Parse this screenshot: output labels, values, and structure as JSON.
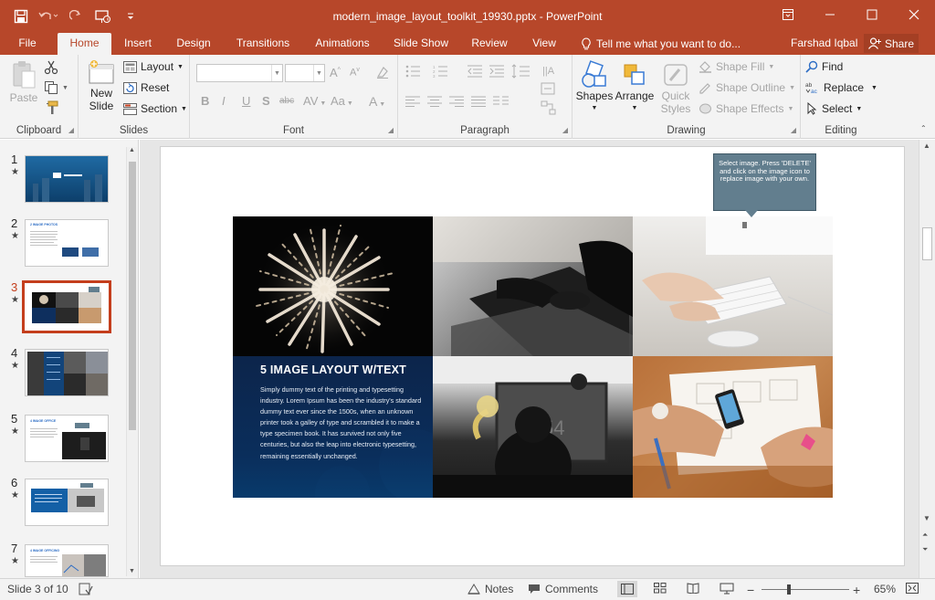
{
  "app": {
    "document_title": "modern_image_layout_toolkit_19930.pptx - PowerPoint"
  },
  "qat": {
    "save_icon": "save-icon",
    "undo_icon": "undo-icon",
    "redo_icon": "redo-icon",
    "present_icon": "present-from-start-icon",
    "customize_icon": "customize-qat-icon"
  },
  "window": {
    "ribbon_display": "ribbon-display-options-icon",
    "minimize": "minimize-icon",
    "restore": "restore-icon",
    "close": "close-icon"
  },
  "tabs": [
    "File",
    "Home",
    "Insert",
    "Design",
    "Transitions",
    "Animations",
    "Slide Show",
    "Review",
    "View"
  ],
  "tell_me": "Tell me what you want to do...",
  "user": "Farshad Iqbal",
  "share": "Share",
  "ribbon": {
    "clipboard": {
      "label": "Clipboard",
      "paste": "Paste"
    },
    "slides": {
      "label": "Slides",
      "new_slide_1": "New",
      "new_slide_2": "Slide",
      "layout": "Layout",
      "reset": "Reset",
      "section": "Section"
    },
    "font": {
      "label": "Font",
      "buttons": [
        "B",
        "I",
        "U",
        "S",
        "abc",
        "AV",
        "Aa",
        "A"
      ]
    },
    "paragraph": {
      "label": "Paragraph"
    },
    "drawing": {
      "label": "Drawing",
      "shapes": "Shapes",
      "arrange": "Arrange",
      "quick_styles_1": "Quick",
      "quick_styles_2": "Styles",
      "shape_fill": "Shape Fill",
      "shape_outline": "Shape Outline",
      "shape_effects": "Shape Effects"
    },
    "editing": {
      "label": "Editing",
      "find": "Find",
      "replace": "Replace",
      "select": "Select"
    }
  },
  "thumbnails": [
    {
      "num": "1",
      "selected": false
    },
    {
      "num": "2",
      "selected": false,
      "heading": "2 IMAGE PHOTOS"
    },
    {
      "num": "3",
      "selected": true
    },
    {
      "num": "4",
      "selected": false
    },
    {
      "num": "5",
      "selected": false,
      "heading": "4 IMAGE OFFICE"
    },
    {
      "num": "6",
      "selected": false
    },
    {
      "num": "7",
      "selected": false,
      "heading": "4 IMAGE OFFICING"
    }
  ],
  "slide": {
    "callout": "Select image. Press 'DELETE' and click on the image icon to replace image with your own.",
    "title": "5 IMAGE LAYOUT W/TEXT",
    "body": "Simply dummy text of the printing and typesetting industry. Lorem Ipsum has been the industry's standard dummy text ever since the 1500s, when an unknown printer took a galley of type and scrambled it to make a type specimen book. It has survived not only five centuries, but also the leap into electronic typesetting, remaining essentially unchanged."
  },
  "status": {
    "slide": "Slide 3 of 10",
    "notes": "Notes",
    "comments": "Comments",
    "zoom": "65%",
    "minus": "−",
    "plus": "+"
  }
}
